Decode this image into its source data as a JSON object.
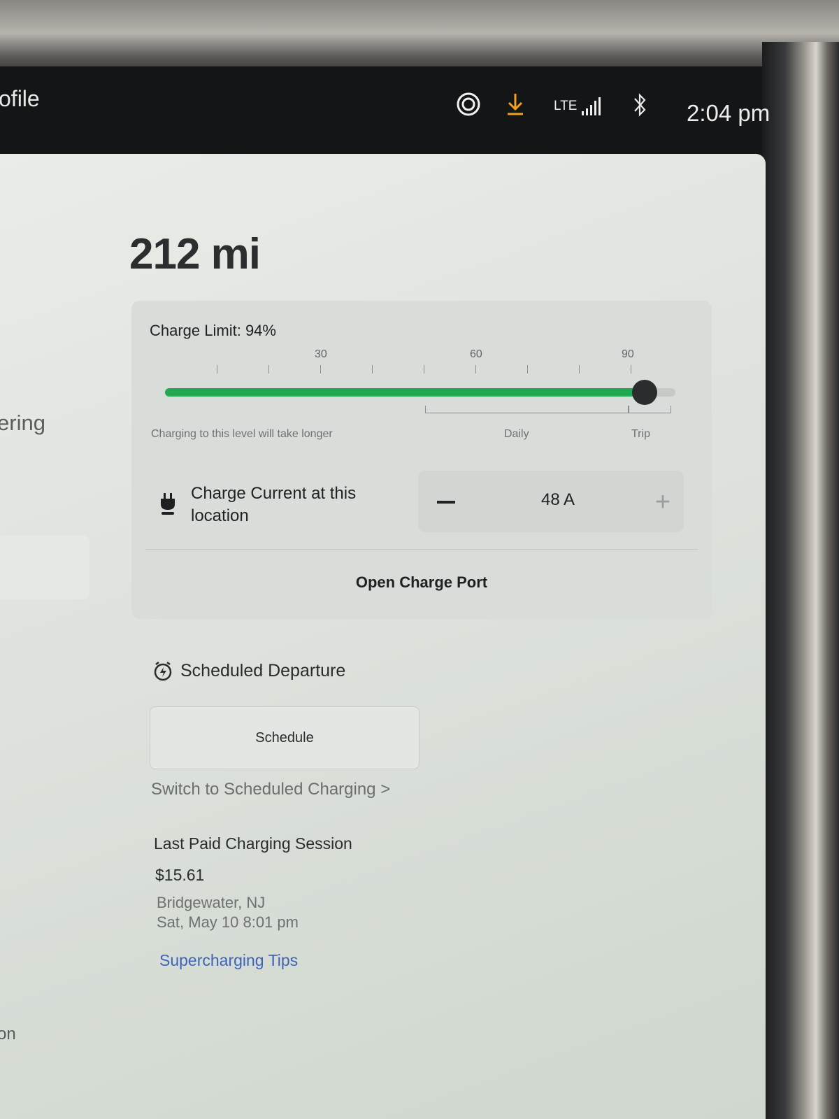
{
  "status_bar": {
    "profile_label": "ofile",
    "icons": [
      "target-icon",
      "download-icon",
      "lte-signal-icon",
      "bluetooth-icon"
    ],
    "lte_label": "LTE",
    "time": "2:04 pm",
    "download_color": "#f0a020"
  },
  "sidebar": {
    "partial_label_1": "ering",
    "partial_label_2": "on"
  },
  "charging": {
    "range": "212 mi",
    "charge_limit_label": "Charge Limit: 94%",
    "charge_limit_percent": 94,
    "tick_labels": [
      "30",
      "60",
      "90"
    ],
    "hint": "Charging to this level will take longer",
    "daily_label": "Daily",
    "trip_label": "Trip",
    "accent_color": "#22a852",
    "current": {
      "label": "Charge Current at this location",
      "value": "48 A",
      "minus_label": "—",
      "plus_label": "+"
    },
    "open_port_label": "Open Charge Port"
  },
  "departure": {
    "title": "Scheduled Departure",
    "schedule_button": "Schedule",
    "switch_link": "Switch to Scheduled Charging >"
  },
  "last_session": {
    "title": "Last Paid Charging Session",
    "amount": "$15.61",
    "location": "Bridgewater, NJ",
    "date": "Sat, May 10 8:01 pm",
    "tips_link": "Supercharging Tips",
    "link_color": "#3e64b8"
  }
}
